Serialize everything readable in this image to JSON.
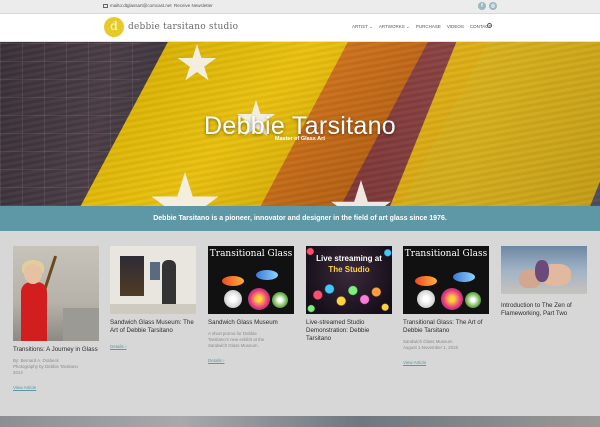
{
  "topbar": {
    "email": "mailto:dtglassart@comcast.net",
    "newsletter": "Receive Newsletter",
    "social": [
      {
        "icon": "facebook-icon",
        "glyph": "f"
      },
      {
        "icon": "instagram-icon",
        "glyph": "◎"
      }
    ]
  },
  "header": {
    "logo_letter": "d",
    "logo_text": "debbie tarsitano studio",
    "nav": [
      "ARTIST ⌄",
      "ARTWORKS ⌄",
      "PURCHASE",
      "VIDEOS",
      "CONTACT"
    ]
  },
  "hero": {
    "title": "Debbie Tarsitano",
    "subtitle": "Master of Glass Art"
  },
  "tagline": "Debbie Tarsitano is a pioneer, innovator and designer in the field of art glass since 1976.",
  "posts": [
    {
      "title": "Transitions: A Journey in Glass",
      "meta_lines": [
        "By: Bernard A. Drabeck",
        "Photography by Debbie Tarsitano",
        "2014"
      ],
      "more": "View Article"
    },
    {
      "title": "Sandwich Glass Museum: The Art of Debbie Tarsitano",
      "meta_lines": [],
      "more": "Details ›"
    },
    {
      "title": "Sandwich Glass Museum",
      "poster_title": "Transitional Glass",
      "meta_lines": [
        "A short promo for Debbie",
        "Tarsitano's new exhibit at the",
        "Sandwich Glass Museum."
      ],
      "more": "Details ›"
    },
    {
      "title": "Live-streamed Studio Demonstration: Debbie Tarsitano",
      "poster_line1": "Live streaming at",
      "poster_line2": "The Studio",
      "meta_lines": [],
      "more": ""
    },
    {
      "title": "Transitional Glass: The Art of Debbie Tarsitano",
      "poster_title": "Transitional Glass",
      "meta_lines": [
        "Sandwich Glass Museum",
        "August 1-November 1, 2015"
      ],
      "more": "View Article"
    },
    {
      "title": "Introduction to The Zen of Flameworking, Part Two",
      "meta_lines": [],
      "more": ""
    }
  ]
}
